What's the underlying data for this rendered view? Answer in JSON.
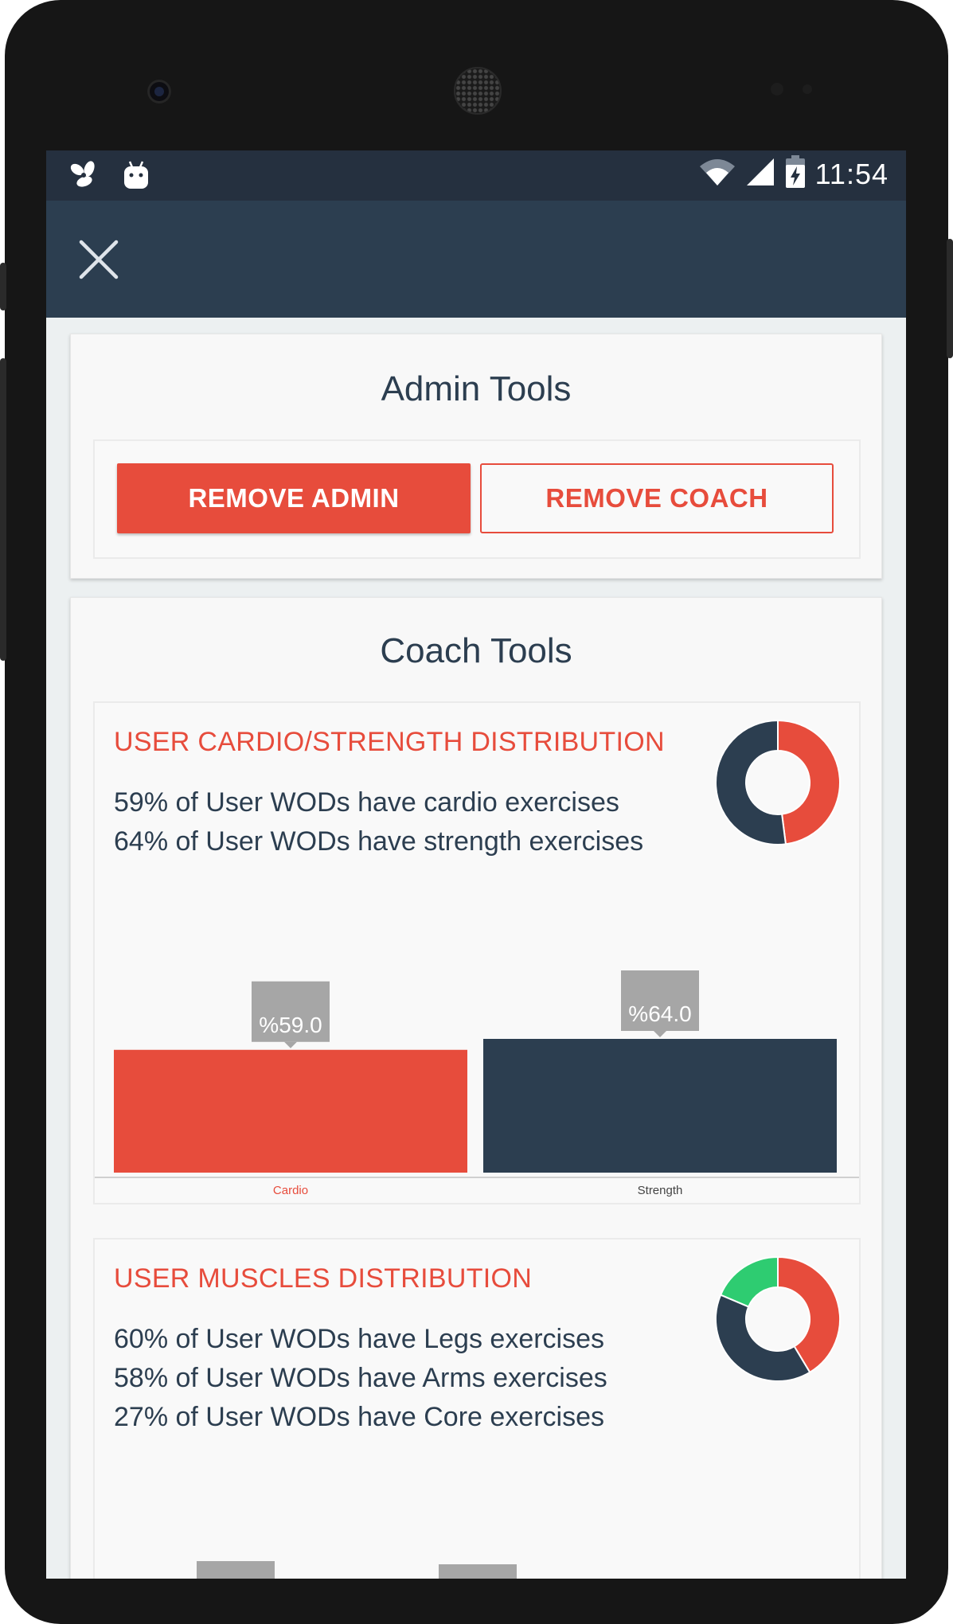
{
  "status_bar": {
    "time": "11:54"
  },
  "admin_tools": {
    "title": "Admin Tools",
    "remove_admin_label": "REMOVE ADMIN",
    "remove_coach_label": "REMOVE COACH"
  },
  "coach_tools": {
    "title": "Coach Tools",
    "cardio_section": {
      "title": "USER CARDIO/STRENGTH DISTRIBUTION",
      "stats": [
        "59% of User WODs have cardio exercises",
        "64% of User WODs have strength exercises"
      ]
    },
    "muscles_section": {
      "title": "USER MUSCLES DISTRIBUTION",
      "stats": [
        "60% of User WODs have Legs exercises",
        "58% of User WODs have Arms exercises",
        "27% of User WODs have Core exercises"
      ]
    }
  },
  "colors": {
    "accent": "#e74c3c",
    "navy": "#2c3e50",
    "green": "#2ecc71",
    "tooltip": "#a6a6a6"
  },
  "icons": [
    "fan-icon",
    "android-icon",
    "wifi-icon",
    "signal-icon",
    "battery-icon",
    "close-icon"
  ],
  "chart_data": [
    {
      "type": "bar",
      "categories": [
        "Cardio",
        "Strength"
      ],
      "values": [
        59.0,
        64.0
      ],
      "data_labels": [
        "%59.0",
        "%64.0"
      ],
      "colors": [
        "#e74c3c",
        "#2c3e50"
      ],
      "ylim": [
        0,
        100
      ]
    },
    {
      "type": "pie",
      "donut": true,
      "slices": [
        {
          "value": 59,
          "color": "#e74c3c"
        },
        {
          "value": 64,
          "color": "#2c3e50"
        }
      ]
    },
    {
      "type": "pie",
      "donut": true,
      "slices": [
        {
          "value": 60,
          "color": "#e74c3c"
        },
        {
          "value": 58,
          "color": "#2c3e50"
        },
        {
          "value": 27,
          "color": "#2ecc71"
        }
      ]
    }
  ]
}
